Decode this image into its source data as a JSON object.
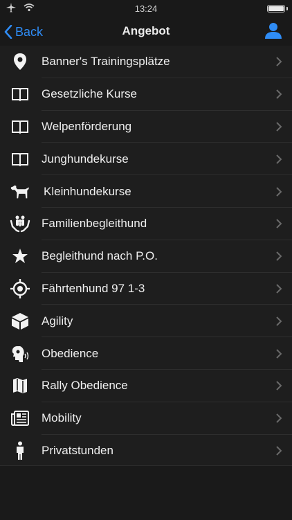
{
  "status_bar": {
    "time": "13:24"
  },
  "nav": {
    "back_label": "Back",
    "title": "Angebot"
  },
  "items": [
    {
      "label": "Banner's Trainingsplätze",
      "icon": "location-pin-icon"
    },
    {
      "label": "Gesetzliche Kurse",
      "icon": "book-icon"
    },
    {
      "label": "Welpenförderung",
      "icon": "book-icon"
    },
    {
      "label": "Junghundekurse",
      "icon": "book-icon"
    },
    {
      "label": "Kleinhundekurse",
      "icon": "dog-icon"
    },
    {
      "label": "Familienbegleithund",
      "icon": "family-hands-icon"
    },
    {
      "label": "Begleithund nach P.O.",
      "icon": "star-icon"
    },
    {
      "label": "Fährtenhund 97 1-3",
      "icon": "target-icon"
    },
    {
      "label": "Agility",
      "icon": "cube-icon"
    },
    {
      "label": "Obedience",
      "icon": "head-speaking-icon"
    },
    {
      "label": "Rally Obedience",
      "icon": "map-icon"
    },
    {
      "label": "Mobility",
      "icon": "newspaper-icon"
    },
    {
      "label": "Privatstunden",
      "icon": "person-icon"
    }
  ],
  "colors": {
    "accent": "#2f8cf5",
    "background": "#1e1e1e",
    "bar": "#191919"
  }
}
